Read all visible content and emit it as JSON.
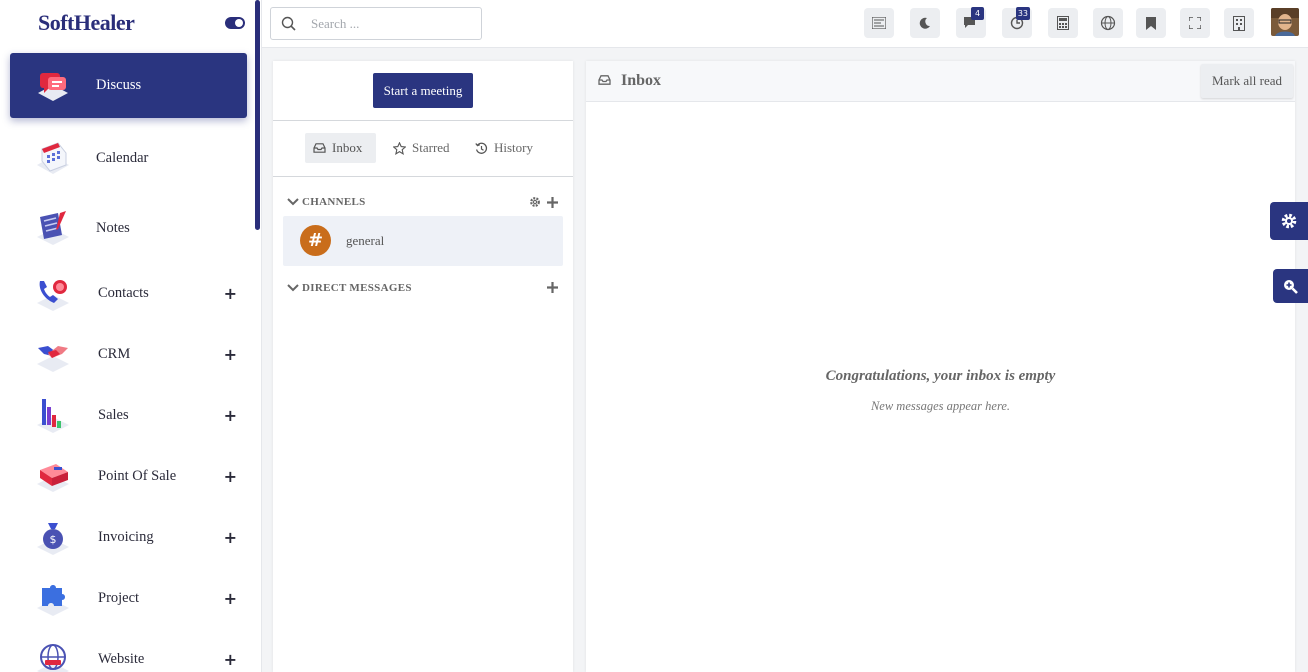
{
  "brand": "SoftHealer",
  "sidebar": {
    "items": [
      {
        "label": "Discuss",
        "has_plus": false
      },
      {
        "label": "Calendar",
        "has_plus": false
      },
      {
        "label": "Notes",
        "has_plus": false
      },
      {
        "label": "Contacts",
        "has_plus": true
      },
      {
        "label": "CRM",
        "has_plus": true
      },
      {
        "label": "Sales",
        "has_plus": true
      },
      {
        "label": "Point Of Sale",
        "has_plus": true
      },
      {
        "label": "Invoicing",
        "has_plus": true
      },
      {
        "label": "Project",
        "has_plus": true
      },
      {
        "label": "Website",
        "has_plus": true
      }
    ],
    "plus_symbol": "+"
  },
  "topbar": {
    "search_placeholder": "Search ...",
    "messages_badge": "4",
    "activity_badge": "33"
  },
  "discuss": {
    "start_meeting": "Start a meeting",
    "tabs": [
      "Inbox",
      "Starred",
      "History"
    ],
    "channels_header": "CHANNELS",
    "channels": [
      {
        "name": "general",
        "avatar": "#"
      }
    ],
    "dm_header": "DIRECT MESSAGES"
  },
  "main": {
    "title": "Inbox",
    "mark_all_read": "Mark all read",
    "empty_title": "Congratulations, your inbox is empty",
    "empty_subtitle": "New messages appear here."
  },
  "colors": {
    "primary": "#2a3580",
    "channel_avatar": "#c96d1b"
  }
}
